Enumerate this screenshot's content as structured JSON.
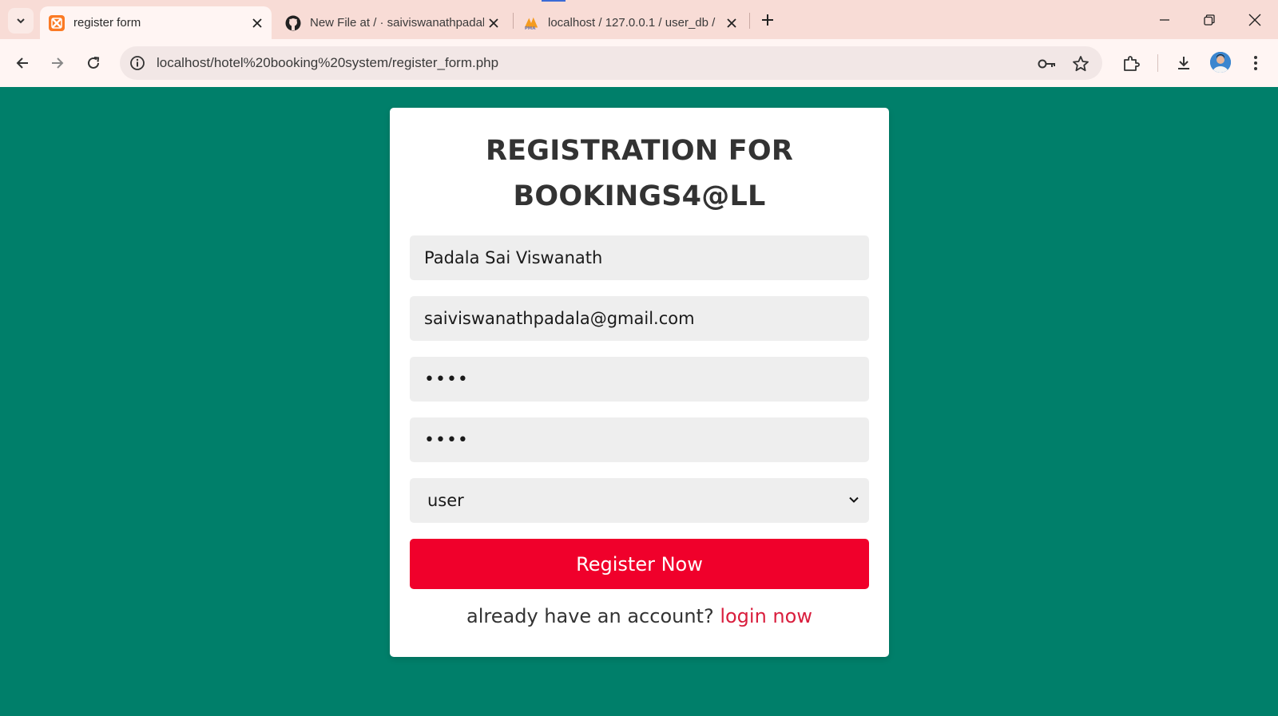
{
  "browser": {
    "tabs": [
      {
        "title": "register form",
        "favicon": "xampp-icon",
        "active": true
      },
      {
        "title": "New File at / · saiviswanathpadala",
        "favicon": "github-icon",
        "active": false
      },
      {
        "title": "localhost / 127.0.0.1 / user_db /",
        "favicon": "phpmyadmin-icon",
        "active": false
      }
    ],
    "url": "localhost/hotel%20booking%20system/register_form.php"
  },
  "form": {
    "title": "REGISTRATION FOR BOOKINGS4@LL",
    "name_value": "Padala Sai Viswanath",
    "email_value": "saiviswanathpadala@gmail.com",
    "password_mask": "••••",
    "confirm_password_mask": "••••",
    "user_type": "user",
    "submit_label": "Register Now",
    "switch_text": "already have an account? ",
    "switch_link": "login now"
  },
  "colors": {
    "page_background": "#007f6a",
    "submit_button": "#f0002b",
    "link": "#d91e3d"
  }
}
